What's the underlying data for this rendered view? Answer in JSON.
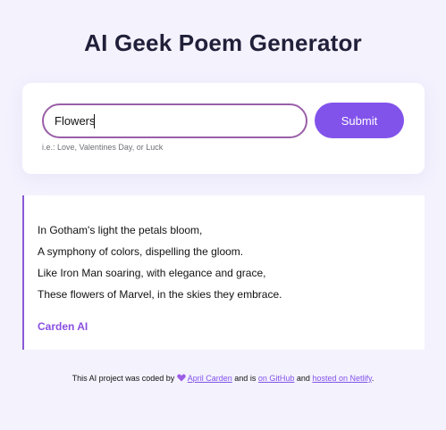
{
  "header": {
    "title": "AI Geek Poem Generator"
  },
  "search": {
    "value": "Flowers",
    "button_label": "Submit",
    "hint": "i.e.: Love, Valentines Day, or Luck"
  },
  "poem": {
    "lines": [
      "In Gotham's light the petals bloom,",
      "A symphony of colors, dispelling the gloom.",
      "Like Iron Man soaring, with elegance and grace,",
      "These flowers of Marvel, in the skies they embrace."
    ],
    "signature": "Carden AI"
  },
  "footer": {
    "prefix": "This AI project was coded by",
    "author_link": "April Carden",
    "middle": "and is",
    "github_link": "on GitHub",
    "and_text": "and",
    "netlify_link": "hosted on Netlify",
    "suffix": ".",
    "heart_icon": "purple-heart-icon"
  },
  "colors": {
    "accent": "#8253eb",
    "background": "#f4f2fd",
    "input_border": "#9a5fa8"
  }
}
